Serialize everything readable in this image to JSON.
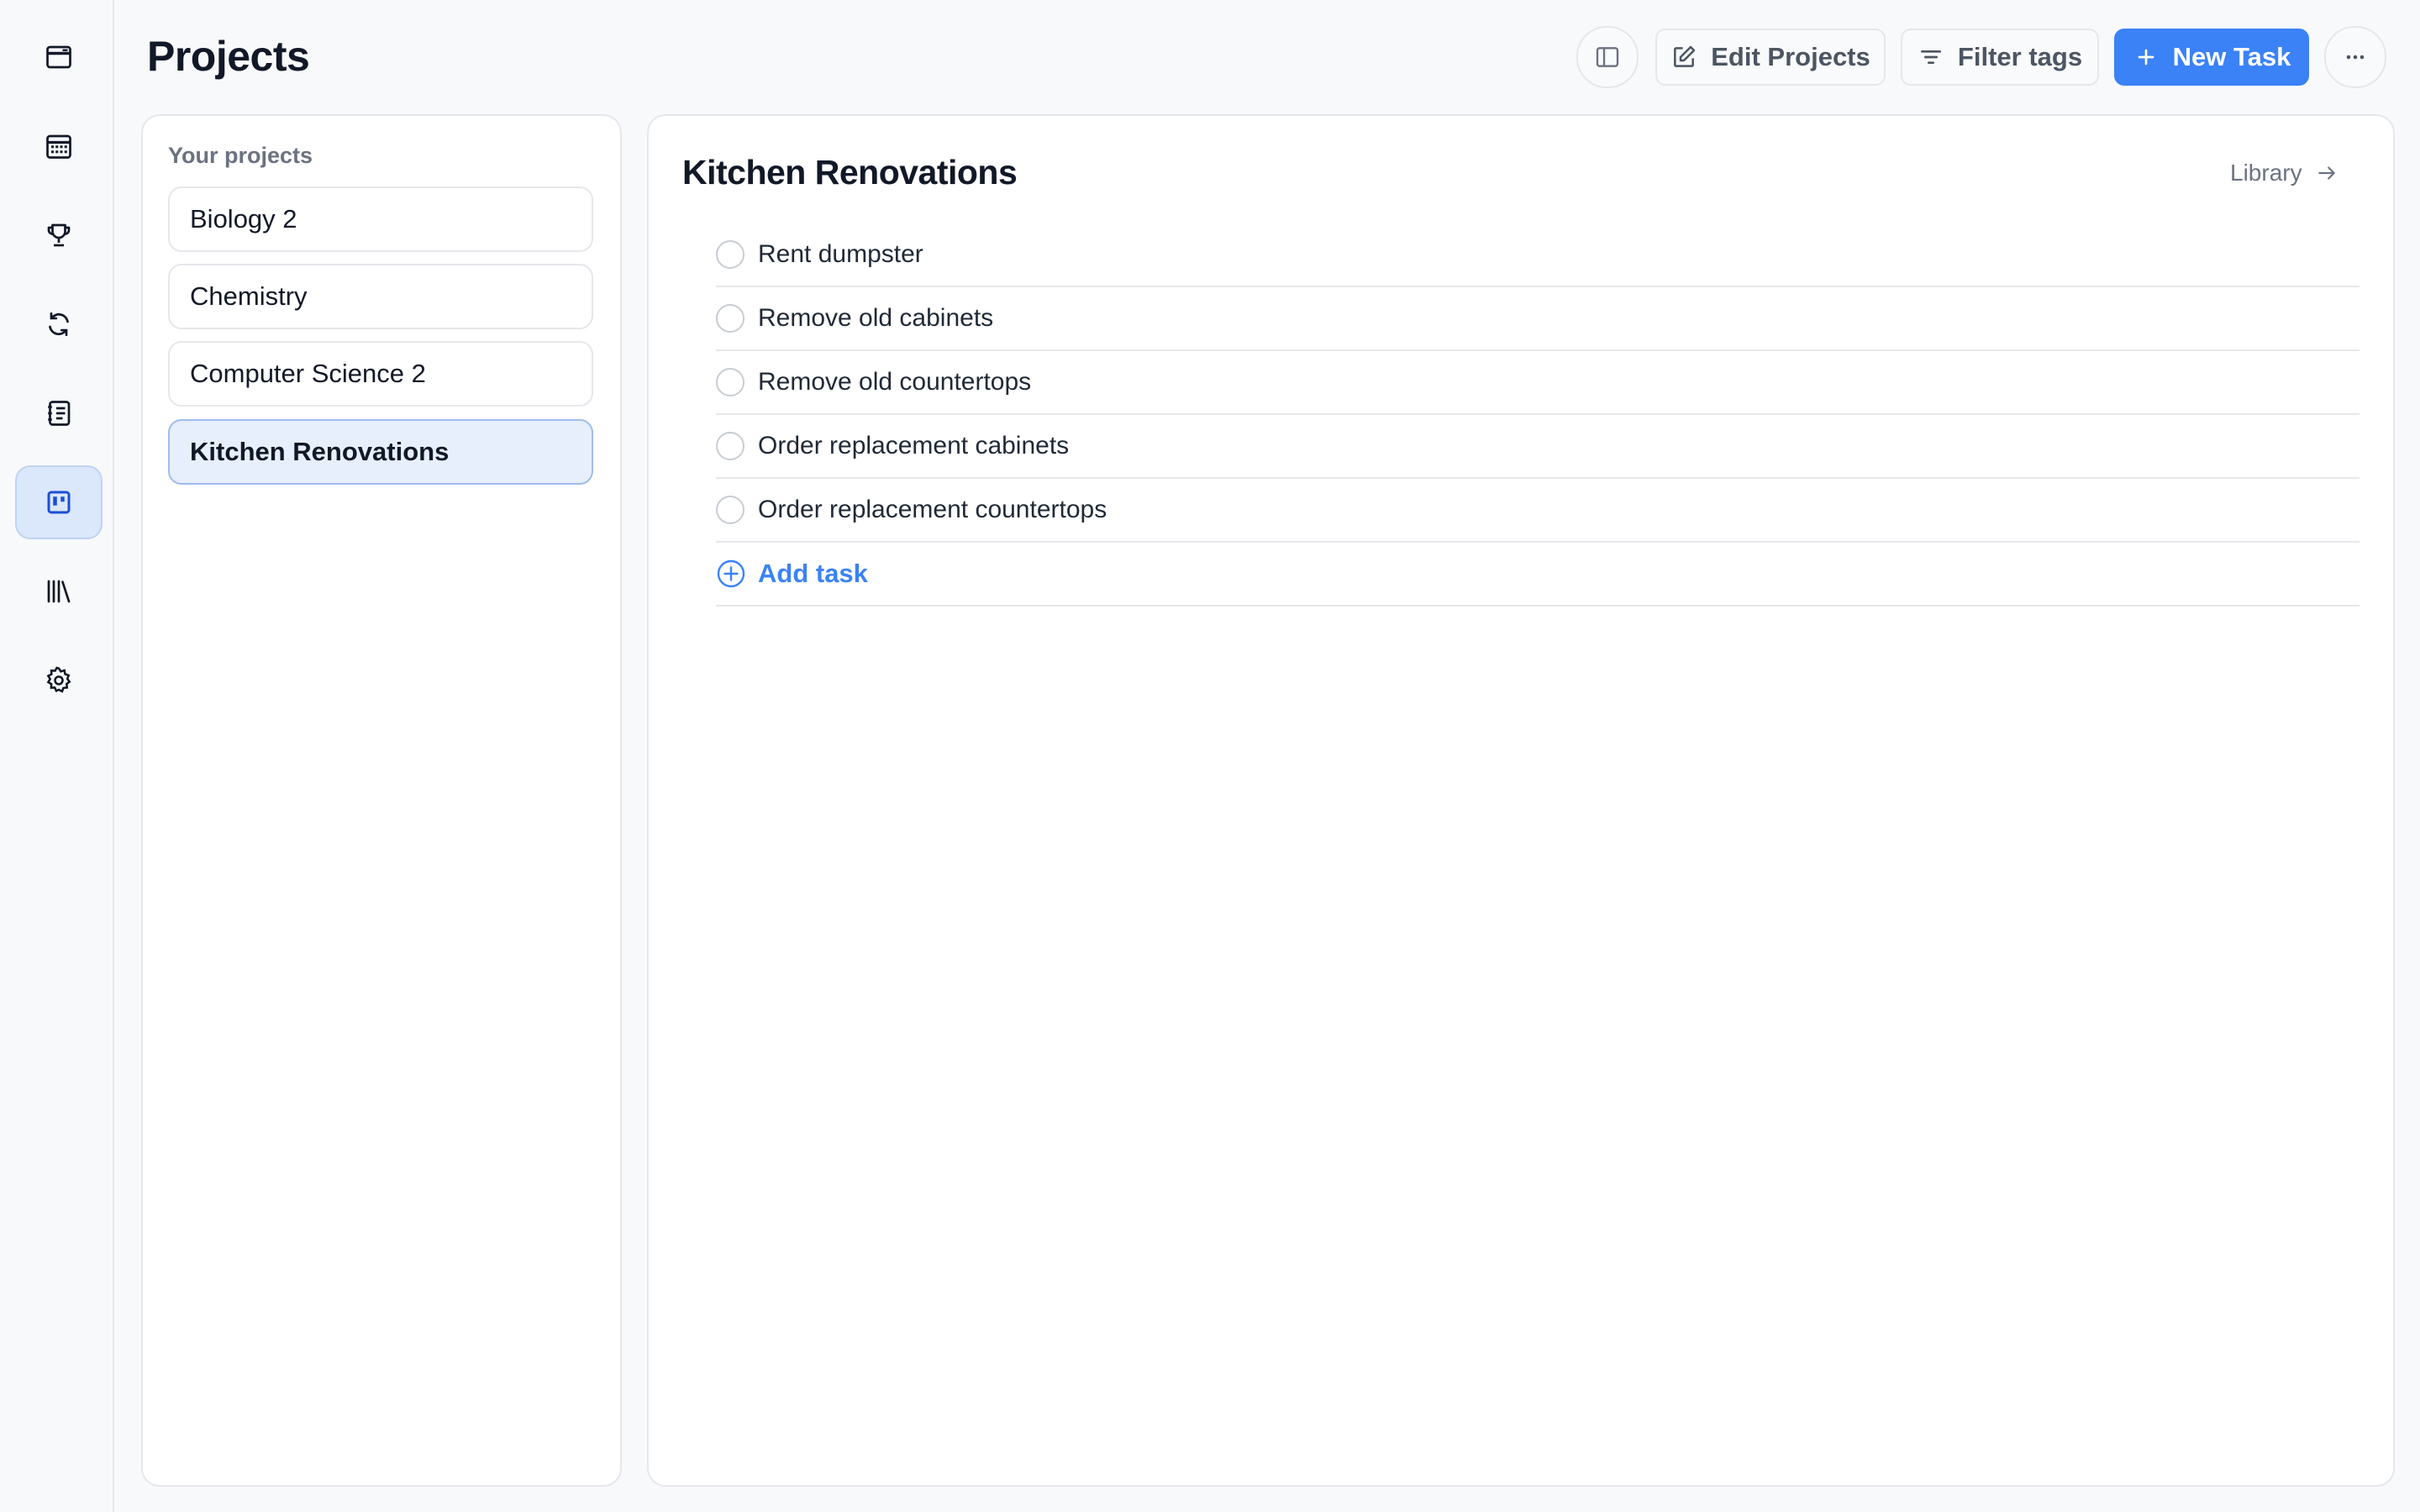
{
  "header": {
    "title": "Projects",
    "edit_projects_label": "Edit Projects",
    "filter_tags_label": "Filter tags",
    "new_task_label": "New Task"
  },
  "rail": {
    "items": [
      {
        "icon": "browser-window-icon"
      },
      {
        "icon": "calendar-icon"
      },
      {
        "icon": "trophy-icon"
      },
      {
        "icon": "sync-icon"
      },
      {
        "icon": "notes-icon"
      },
      {
        "icon": "kanban-board-icon",
        "active": true
      },
      {
        "icon": "library-icon"
      },
      {
        "icon": "gear-icon"
      }
    ]
  },
  "projects": {
    "heading": "Your projects",
    "items": [
      {
        "label": "Biology 2"
      },
      {
        "label": "Chemistry"
      },
      {
        "label": "Computer Science 2"
      },
      {
        "label": "Kitchen Renovations",
        "active": true
      }
    ]
  },
  "main": {
    "title": "Kitchen Renovations",
    "library_label": "Library",
    "tasks": [
      {
        "label": "Rent dumpster"
      },
      {
        "label": "Remove old cabinets"
      },
      {
        "label": "Remove old countertops"
      },
      {
        "label": "Order replacement cabinets"
      },
      {
        "label": "Order replacement countertops"
      }
    ],
    "add_task_label": "Add task"
  },
  "colors": {
    "accent": "#3b82f6",
    "active_bg": "#e7effc",
    "text": "#111827",
    "muted": "#6b7280"
  }
}
